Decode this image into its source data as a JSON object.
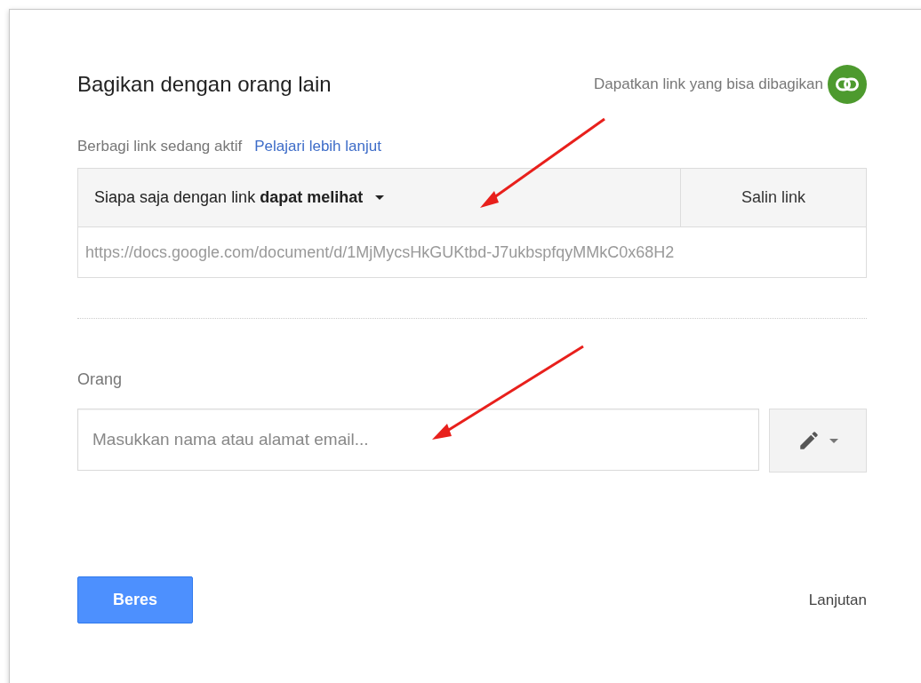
{
  "dialog": {
    "title": "Bagikan dengan orang lain",
    "get_link": {
      "label": "Dapatkan link yang bisa dibagikan"
    }
  },
  "link_sharing": {
    "status": "Berbagi link sedang aktif",
    "learn_more": "Pelajari lebih lanjut",
    "access": "Siapa saja dengan link **dapat melihat**",
    "copy_button": "Salin link",
    "url": "https://docs.google.com/document/d/1MjMycsHkGUKtbd-J7ukbspfqyMMkC0x68H2"
  },
  "people": {
    "label": "Orang",
    "placeholder": "Masukkan nama atau alamat email..."
  },
  "footer": {
    "done_button": "Beres",
    "advanced_link": "Lanjutan"
  }
}
